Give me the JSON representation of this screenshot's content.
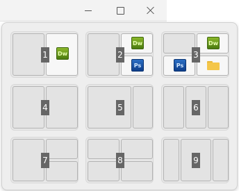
{
  "window": {
    "controls": [
      "minimize",
      "maximize",
      "close"
    ]
  },
  "snap_layouts": [
    {
      "number": "1",
      "apps": [
        "Dw"
      ]
    },
    {
      "number": "2",
      "apps": [
        "Dw",
        "Ps"
      ]
    },
    {
      "number": "3",
      "apps": [
        "Dw",
        "Ps",
        "folder"
      ]
    },
    {
      "number": "4",
      "apps": []
    },
    {
      "number": "5",
      "apps": []
    },
    {
      "number": "6",
      "apps": []
    },
    {
      "number": "7",
      "apps": []
    },
    {
      "number": "8",
      "apps": []
    },
    {
      "number": "9",
      "apps": []
    }
  ],
  "app_labels": {
    "dreamweaver": "Dw",
    "photoshop": "Ps"
  },
  "colors": {
    "dreamweaver_icon": "#6a9a1a",
    "photoshop_icon": "#1a4f9e",
    "folder_icon": "#f4c64a",
    "number_badge": "#666666"
  }
}
